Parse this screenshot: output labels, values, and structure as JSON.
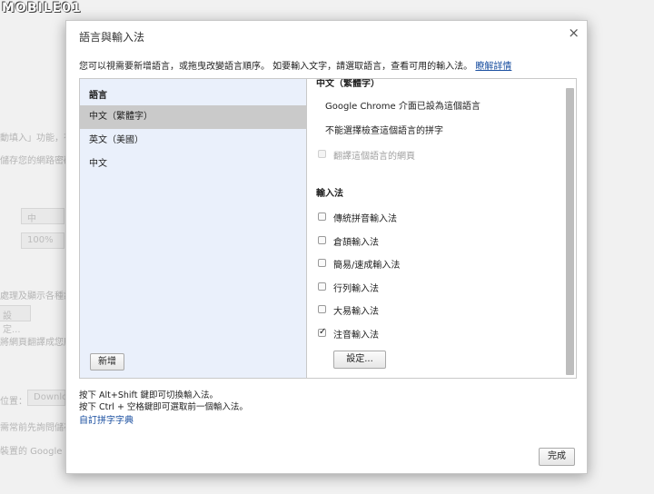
{
  "logo_text": "MOBILE01",
  "background": {
    "texts": [
      "動填入」功能，有",
      "儲存您的網路密碼",
      "處理及顯示各種語",
      "將網頁翻譯成您所",
      "位置：",
      "需常前先詢問儲存",
      "裝置的 Google 雲"
    ],
    "font_size_value": "中",
    "zoom_value": "100%",
    "settings_button": "設定...",
    "download_placeholder": "Downloa"
  },
  "dialog": {
    "title": "語言與輸入法",
    "close_symbol": "×",
    "description": "您可以視需要新增語言，或拖曳改變語言順序。 如要輸入文字，請選取語言，查看可用的輸入法。",
    "learn_more": "瞭解詳情",
    "languages_header": "語言",
    "languages": [
      "中文（繁體字）",
      "英文（美國）",
      "中文"
    ],
    "add_button": "新增",
    "right": {
      "section_header": "中文（繁體字）",
      "ui_language_note": "Google Chrome 介面已設為這個語言",
      "spellcheck_note": "不能選擇檢查這個語言的拼字",
      "translate_label": "翻譯這個語言的網頁",
      "input_methods_header": "輸入法",
      "input_methods": [
        {
          "label": "傳統拼音輸入法",
          "checked": false
        },
        {
          "label": "倉頡輸入法",
          "checked": false
        },
        {
          "label": "簡易/速成輸入法",
          "checked": false
        },
        {
          "label": "行列輸入法",
          "checked": false
        },
        {
          "label": "大易輸入法",
          "checked": false
        },
        {
          "label": "注音輸入法",
          "checked": true
        }
      ],
      "settings_button": "設定..."
    },
    "hint1": "按下 Alt+Shift 鍵即可切換輸入法。",
    "hint2": "按下 Ctrl + 空格鍵即可選取前一個輸入法。",
    "custom_dictionary_link": "自訂拼字字典",
    "done_button": "完成"
  }
}
